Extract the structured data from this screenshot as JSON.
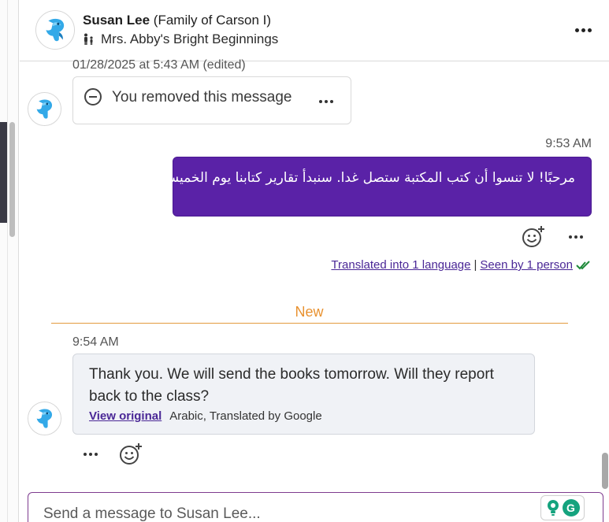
{
  "colors": {
    "accent_purple": "#5a22a7",
    "link_purple": "#4a2796",
    "new_orange": "#e8912f",
    "read_check_green": "#1f8a3a"
  },
  "header": {
    "contact_name": "Susan Lee",
    "contact_relation": "(Family of Carson I)",
    "class_name": "Mrs. Abby's Bright Beginnings",
    "class_icon": "family-icon",
    "menu_icon": "more-horizontal-icon"
  },
  "messages": [
    {
      "timestamp": "01/28/2025 at 5:43 AM (edited)",
      "text": "You removed this message",
      "icon": "minus-circle-icon"
    },
    {
      "timestamp": "9:53 AM",
      "text": "مرحبًا! لا تنسوا أن كتب المكتبة ستصل غدا. سنبدأ تقارير كتابنا يوم الخميس."
    },
    {
      "timestamp": "9:54 AM",
      "text": "Thank you. We will send the books tomorrow. Will they report back to the class?",
      "view_original_label": "View original",
      "translation_note": "Arabic, Translated by Google"
    }
  ],
  "status": {
    "translated_label": "Translated into 1 language",
    "separator": "|",
    "seen_label": "Seen by 1 person"
  },
  "new_divider_label": "New",
  "composer": {
    "placeholder": "Send a message to Susan Lee..."
  },
  "extension": {
    "grammarly_letter": "G"
  }
}
